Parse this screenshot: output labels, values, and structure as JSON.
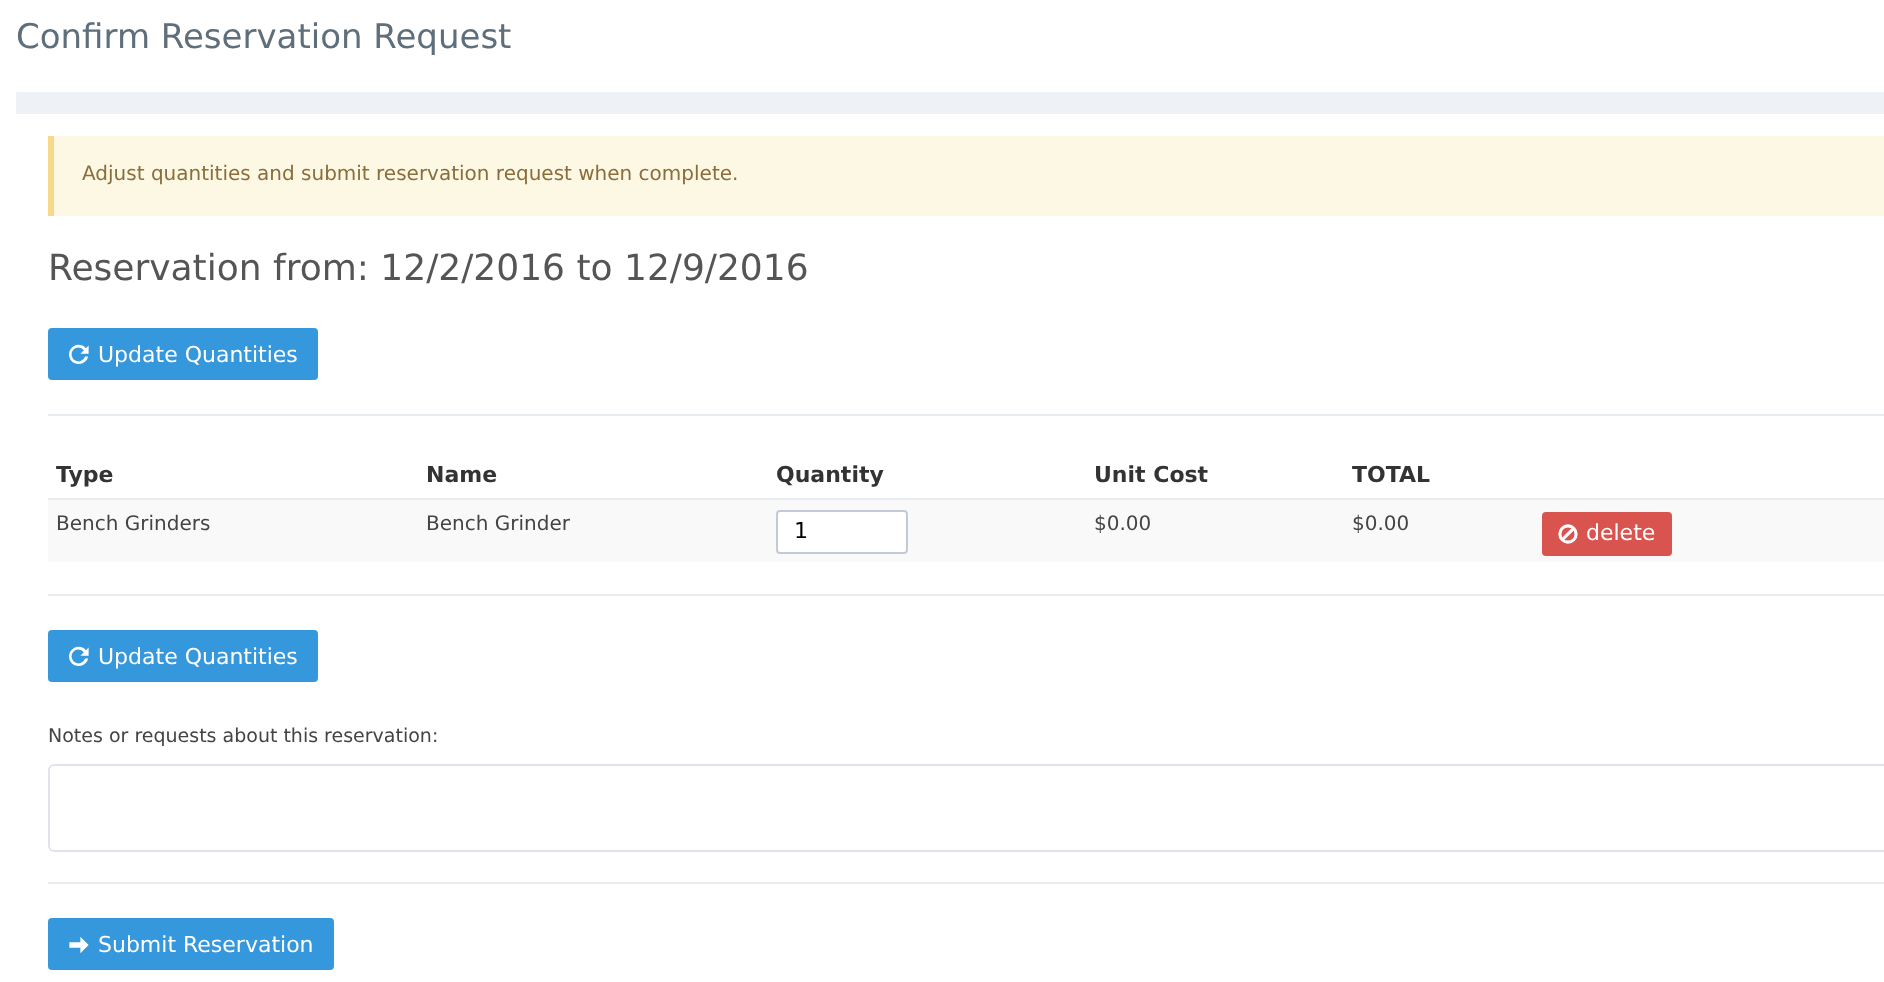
{
  "page_title": "Confirm Reservation Request",
  "alert": "Adjust quantities and submit reservation request when complete.",
  "reservation_heading": "Reservation from: 12/2/2016 to 12/9/2016",
  "update_button_top": "Update Quantities",
  "table": {
    "columns": [
      "Type",
      "Name",
      "Quantity",
      "Unit Cost",
      "TOTAL"
    ],
    "rows": [
      {
        "type": "Bench Grinders",
        "name": "Bench Grinder",
        "quantity": "1",
        "unit_cost": "$0.00",
        "total": "$0.00",
        "delete": "delete"
      }
    ]
  },
  "update_button_bottom": "Update Quantities",
  "notes_label": "Notes or requests about this reservation:",
  "submit_button": "Submit Reservation"
}
